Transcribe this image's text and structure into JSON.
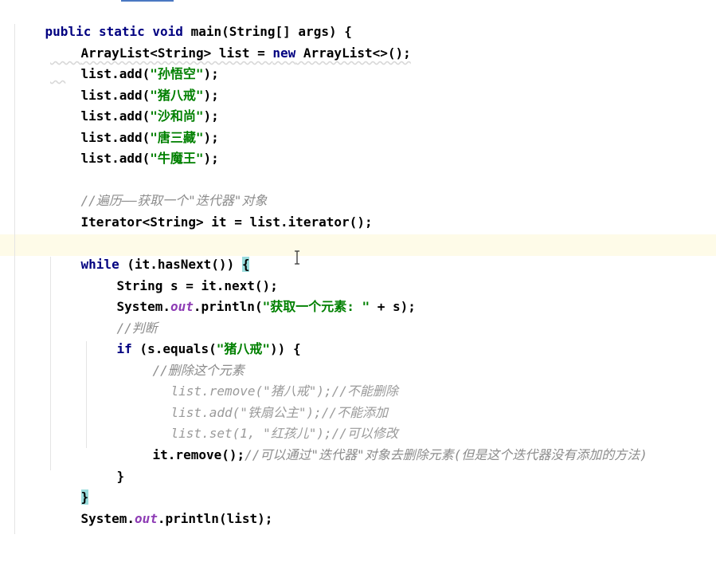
{
  "code": {
    "l1": {
      "kw1": "public static void",
      "name": "main",
      "rest": "(String[] args) {"
    },
    "l2": {
      "a": "ArrayList<String> list = ",
      "kw": "new",
      "b": " ArrayList<>();"
    },
    "l3": {
      "a": "list.add(",
      "s": "\"孙悟空\"",
      "b": ");"
    },
    "l4": {
      "a": "list.add(",
      "s": "\"猪八戒\"",
      "b": ");"
    },
    "l5": {
      "a": "list.add(",
      "s": "\"沙和尚\"",
      "b": ");"
    },
    "l6": {
      "a": "list.add(",
      "s": "\"唐三藏\"",
      "b": ");"
    },
    "l7": {
      "a": "list.add(",
      "s": "\"牛魔王\"",
      "b": ");"
    },
    "l8": {
      "c": "//遍历——获取一个\"迭代器\"对象"
    },
    "l9": {
      "a": "Iterator<String> it = list.iterator();"
    },
    "l10": {
      "kw": "while",
      "a": " (it.hasNext()) ",
      "brace": "{"
    },
    "l11": {
      "a": "String s = it.next();"
    },
    "l12": {
      "a": "System.",
      "f": "out",
      "b": ".println(",
      "s": "\"获取一个元素: \"",
      "c": " + s);"
    },
    "l13": {
      "c": "//判断"
    },
    "l14": {
      "kw": "if",
      "a": " (s.equals(",
      "s": "\"猪八戒\"",
      "b": ")) {"
    },
    "l15": {
      "c": "//删除这个元素"
    },
    "l16": {
      "d": "list.remove(\"猪八戒\");//不能删除"
    },
    "l17": {
      "d": "list.add(\"铁扇公主\");//不能添加"
    },
    "l18": {
      "d": "list.set(1, \"红孩儿\");//可以修改"
    },
    "l19": {
      "a": "it.remove();",
      "c": "//可以通过\"迭代器\"对象去删除元素(但是这个迭代器没有添加的方法)"
    },
    "l20": {
      "a": "}"
    },
    "l21": {
      "brace": "}"
    },
    "l22": {
      "a": "System.",
      "f": "out",
      "b": ".println(list);"
    },
    "l23": {
      "a": "}"
    }
  },
  "colors": {
    "keyword": "#000080",
    "string": "#008000",
    "static_field": "#8e3cb5",
    "comment": "#8c8c8c",
    "caret_row": "#fefbe8",
    "brace_match": "#99dcdc"
  },
  "icons": {
    "cursor": "text-cursor-icon"
  }
}
